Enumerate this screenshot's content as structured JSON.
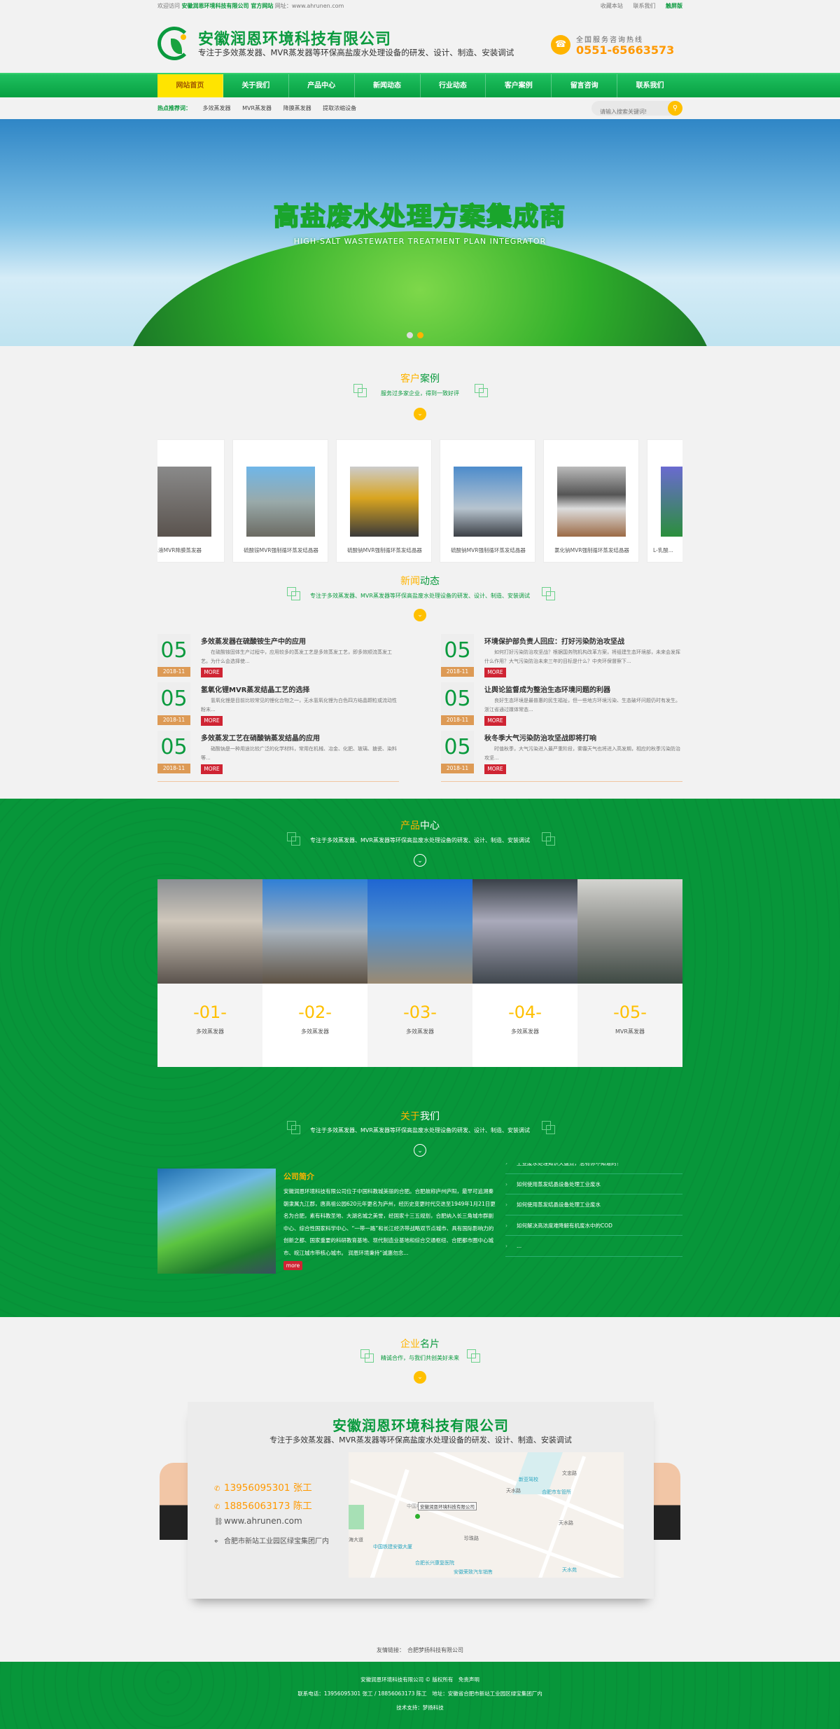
{
  "topbar": {
    "welcome": "欢迎访问",
    "company": "安徽润恩环境科技有限公司 官方网站",
    "site_label": "网址：",
    "site": "www.ahrunen.com",
    "links": [
      "收藏本站",
      "联系我们"
    ],
    "mobile": "触屏版"
  },
  "header": {
    "company_name": "安徽润恩环境科技有限公司",
    "slogan": "专注于多效蒸发器、MVR蒸发器等环保高盐废水处理设备的研发、设计、制造、安装调试",
    "hotline_label": "全国服务咨询热线",
    "hotline": "0551-65663573"
  },
  "nav": {
    "items": [
      "网站首页",
      "关于我们",
      "产品中心",
      "新闻动态",
      "行业动态",
      "客户案例",
      "留言咨询",
      "联系我们"
    ],
    "active": 0
  },
  "hot": {
    "label": "热点推荐词：",
    "keywords": [
      "多效蒸发器",
      "MVR蒸发器",
      "降膜蒸发器",
      "提取浓缩设备"
    ],
    "search_placeholder": "请输入搜索关键词!"
  },
  "banner": {
    "title": "高盐废水处理方案集成商",
    "subtitle": "HIGH-SALT WASTEWATER TREATMENT PLAN INTEGRATOR",
    "slides": 2,
    "active_slide": 1
  },
  "cases": {
    "title_a": "客户",
    "title_b": "案例",
    "subtitle": "服务过多家企业，得到一致好评",
    "items": [
      "...液MVR降膜蒸发器",
      "硫酸铵MVR强制循环蒸发结晶器",
      "硫酸钠MVR强制循环蒸发结晶器",
      "硫酸钠MVR强制循环蒸发结晶器",
      "氯化钠MVR强制循环蒸发结晶器",
      "L-乳酸..."
    ]
  },
  "news": {
    "title_a": "新闻",
    "title_b": "动态",
    "subtitle": "专注于多效蒸发器、MVR蒸发器等环保高盐废水处理设备的研发、设计、制造、安装调试",
    "more": "MORE",
    "left": [
      {
        "day": "05",
        "date": "2018-11",
        "title": "多效蒸发器在硫酸铵生产中的应用",
        "desc": "在硫酸铵固体生产过程中，应用较多的蒸发工艺是多效蒸发工艺，即多效顺流蒸发工艺。为什么会选择使..."
      },
      {
        "day": "05",
        "date": "2018-11",
        "title": "氢氧化锂MVR蒸发结晶工艺的选择",
        "desc": "氢氧化锂是目前比较常见的锂化合物之一，无水氢氧化锂为白色四方结晶颗粒或流动性粉末..."
      },
      {
        "day": "05",
        "date": "2018-11",
        "title": "多效蒸发工艺在硝酸钠蒸发结晶的应用",
        "desc": "硝酸钠是一种用途比较广泛的化学材料，常用在机械、冶金、化肥、玻璃、搪瓷、染料等..."
      }
    ],
    "right": [
      {
        "day": "05",
        "date": "2018-11",
        "title": "环境保护部负责人回应：打好污染防治攻坚战",
        "desc": "如何打好污染防治攻坚战？根据国务院机构改革方案，将组建生态环境部，未来会发挥什么作用？大气污染防治未来三年的目标是什么？中央环保督察下..."
      },
      {
        "day": "05",
        "date": "2018-11",
        "title": "让舆论监督成为整治生态环境问题的利器",
        "desc": "良好生态环境是最普惠的民生福祉，但一些地方环境污染、生态破坏问题仍时有发生。浙江省通过媒体常态..."
      },
      {
        "day": "05",
        "date": "2018-11",
        "title": "秋冬季大气污染防治攻坚战即将打响",
        "desc": "时值秋季，大气污染进入最严重阶段，雾霾天气也将进入高发期，相应的秋季污染防治攻坚..."
      }
    ]
  },
  "products": {
    "title_a": "产品",
    "title_b": "中心",
    "subtitle": "专注于多效蒸发器、MVR蒸发器等环保高盐废水处理设备的研发、设计、制造、安装调试",
    "items": [
      {
        "num": "-01-",
        "name": "多效蒸发器"
      },
      {
        "num": "-02-",
        "name": "多效蒸发器"
      },
      {
        "num": "-03-",
        "name": "多效蒸发器"
      },
      {
        "num": "-04-",
        "name": "多效蒸发器"
      },
      {
        "num": "-05-",
        "name": "MVR蒸发器"
      }
    ]
  },
  "about": {
    "title_a": "关于",
    "title_b": "我们",
    "subtitle": "专注于多效蒸发器、MVR蒸发器等环保高盐废水处理设备的研发、设计、制造、安装调试",
    "heading": "公司简介",
    "text": "安徽润恩环境科技有限公司位于中国科教城美丽的合肥。合肥故称庐州庐阳，最早可追溯秦朝隶属九江郡，唐高祖公园620元年更名为庐州，经历史变更时代交迭至1949年1月21日更名为合肥，素有科教圣地、大湖名城之美誉，经国家十三五规划，合肥纳入长三角城市群副中心、综合性国家科学中心、“一带一路”和长江经济带战略双节点城市、具有国际影响力的创新之都、国家重要的科研教育基地、现代制造业基地和综合交通枢纽、合肥都市圈中心城市、皖江城市带核心城市。 润恩环境秉持“诚惠勿念...",
    "more": "more",
    "list": [
      "工业废水处理知识大盘点，总有你不知道的！",
      "如何使用蒸发结晶设备处理工业废水",
      "如何使用蒸发结晶设备处理工业废水",
      "如何解决高浓度难降解有机废水中的COD",
      "..."
    ]
  },
  "bizcard": {
    "title_a": "企业",
    "title_b": "名片",
    "subtitle": "精诚合作，与我们共创美好未来",
    "company": "安徽润恩环境科技有限公司",
    "slogan": "专注于多效蒸发器、MVR蒸发器等环保高盐废水处理设备的研发、设计、制造、安装调试",
    "phone1": "13956095301 张工",
    "phone2": "18856063173 陈工",
    "website": "www.ahrunen.com",
    "address": "合肥市新站工业园区绿宝集团厂内",
    "map": {
      "pin": "安徽润恩环境科技有限公司",
      "labels": [
        "新亚驾校",
        "合肥市车管所",
        "天水路",
        "天水路",
        "中国电子集团",
        "中国铁建安徽大厦",
        "合肥长兴康复医院",
        "安徽荣致汽车销售",
        "天水苑",
        "珍珠路",
        "文忠路",
        "海大道"
      ]
    }
  },
  "footer": {
    "links_label": "友情链接：",
    "links": [
      "合肥梦扬科技有限公司"
    ],
    "copyright": "安徽润恩环境科技有限公司 © 版权所有　免责声明",
    "contact": "联系电话：13956095301 张工 / 18856063173 陈工　地址：安徽省合肥市新站工业园区绿宝集团厂内",
    "support": "技术支持：梦扬科技"
  },
  "colors": {
    "brand_green": "#0a9a3e",
    "accent_yellow": "#ffc000",
    "orange": "#ff9900",
    "more_red": "#cf2433",
    "date_tan": "#dd9a55"
  }
}
